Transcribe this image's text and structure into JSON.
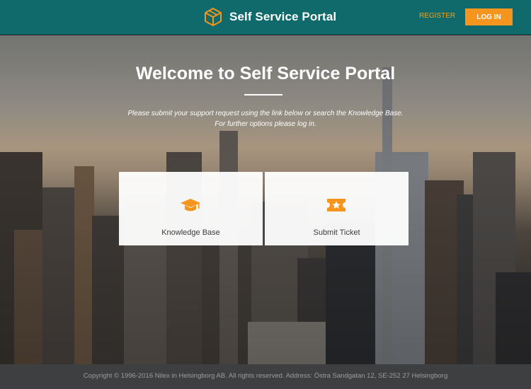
{
  "header": {
    "brand_name": "Self Service Portal",
    "register_label": "REGISTER",
    "login_label": "LOG IN"
  },
  "hero": {
    "title": "Welcome to Self Service Portal",
    "subtitle_line1": "Please submit your support request using the link below or search the Knowledge Base.",
    "subtitle_line2": "For further options please log in."
  },
  "cards": [
    {
      "label": "Knowledge Base",
      "icon": "graduation-cap-icon"
    },
    {
      "label": "Submit Ticket",
      "icon": "ticket-star-icon"
    }
  ],
  "footer": {
    "text": "Copyright © 1996-2016 Nilex in Helsingborg AB. All rights reserved. Address: Östra Sandgatan 12, SE-252 27 Helsingborg"
  },
  "colors": {
    "header_bg": "#106a6c",
    "accent": "#f5951e",
    "footer_bg": "#3e3f41"
  }
}
